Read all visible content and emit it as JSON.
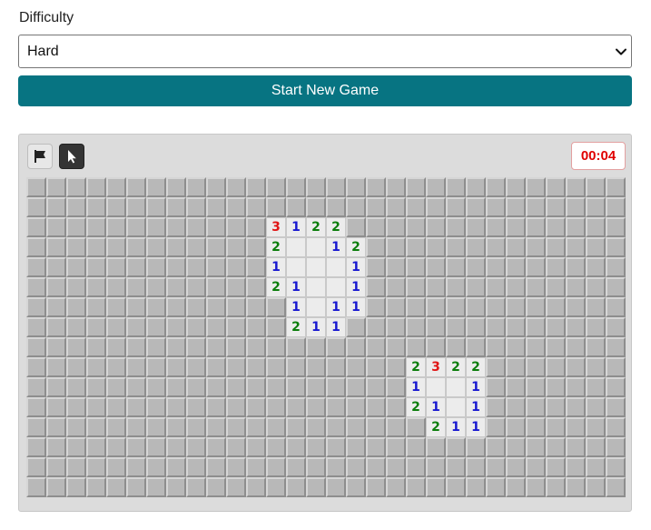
{
  "difficulty": {
    "label": "Difficulty",
    "selected": "Hard"
  },
  "start_button": {
    "label": "Start New Game",
    "color": "#077482"
  },
  "toolbar": {
    "flag_tool_icon": "flag-icon",
    "reveal_tool_icon": "pointer-cursor-icon",
    "active_tool": "reveal"
  },
  "timer": "00:04",
  "board": {
    "rows": 16,
    "cols": 30,
    "revealed": [
      {
        "r": 2,
        "c": 12,
        "v": "3"
      },
      {
        "r": 2,
        "c": 13,
        "v": "1"
      },
      {
        "r": 2,
        "c": 14,
        "v": "2"
      },
      {
        "r": 2,
        "c": 15,
        "v": "2"
      },
      {
        "r": 3,
        "c": 12,
        "v": "2"
      },
      {
        "r": 3,
        "c": 13,
        "v": ""
      },
      {
        "r": 3,
        "c": 14,
        "v": ""
      },
      {
        "r": 3,
        "c": 15,
        "v": "1"
      },
      {
        "r": 3,
        "c": 16,
        "v": "2"
      },
      {
        "r": 4,
        "c": 12,
        "v": "1"
      },
      {
        "r": 4,
        "c": 13,
        "v": ""
      },
      {
        "r": 4,
        "c": 14,
        "v": ""
      },
      {
        "r": 4,
        "c": 15,
        "v": ""
      },
      {
        "r": 4,
        "c": 16,
        "v": "1"
      },
      {
        "r": 5,
        "c": 12,
        "v": "2"
      },
      {
        "r": 5,
        "c": 13,
        "v": "1"
      },
      {
        "r": 5,
        "c": 14,
        "v": ""
      },
      {
        "r": 5,
        "c": 15,
        "v": ""
      },
      {
        "r": 5,
        "c": 16,
        "v": "1"
      },
      {
        "r": 6,
        "c": 13,
        "v": "1"
      },
      {
        "r": 6,
        "c": 14,
        "v": ""
      },
      {
        "r": 6,
        "c": 15,
        "v": "1"
      },
      {
        "r": 6,
        "c": 16,
        "v": "1"
      },
      {
        "r": 7,
        "c": 13,
        "v": "2"
      },
      {
        "r": 7,
        "c": 14,
        "v": "1"
      },
      {
        "r": 7,
        "c": 15,
        "v": "1"
      },
      {
        "r": 9,
        "c": 19,
        "v": "2"
      },
      {
        "r": 9,
        "c": 20,
        "v": "3"
      },
      {
        "r": 9,
        "c": 21,
        "v": "2"
      },
      {
        "r": 9,
        "c": 22,
        "v": "2"
      },
      {
        "r": 10,
        "c": 19,
        "v": "1"
      },
      {
        "r": 10,
        "c": 20,
        "v": ""
      },
      {
        "r": 10,
        "c": 21,
        "v": ""
      },
      {
        "r": 10,
        "c": 22,
        "v": "1"
      },
      {
        "r": 11,
        "c": 19,
        "v": "2"
      },
      {
        "r": 11,
        "c": 20,
        "v": "1"
      },
      {
        "r": 11,
        "c": 21,
        "v": ""
      },
      {
        "r": 11,
        "c": 22,
        "v": "1"
      },
      {
        "r": 12,
        "c": 20,
        "v": "2"
      },
      {
        "r": 12,
        "c": 21,
        "v": "1"
      },
      {
        "r": 12,
        "c": 22,
        "v": "1"
      }
    ]
  }
}
